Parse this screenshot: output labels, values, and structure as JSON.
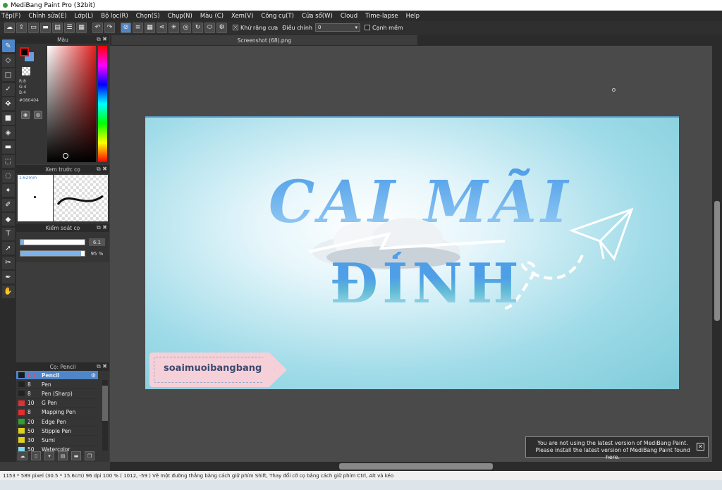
{
  "window": {
    "title": "MediBang Paint Pro (32bit)"
  },
  "menu": [
    "Tệp(F)",
    "Chỉnh sửa(E)",
    "Lớp(L)",
    "Bộ lọc(R)",
    "Chọn(S)",
    "Chụp(N)",
    "Màu (C)",
    "Xem(V)",
    "Công cụ(T)",
    "Cửa sổ(W)",
    "Cloud",
    "Time-lapse",
    "Help"
  ],
  "toolbar": {
    "antialias_label": "Khử răng cưa",
    "adjust_label": "Điều chỉnh",
    "adjust_value": "0",
    "soft_edge_label": "Cạnh mềm"
  },
  "color_panel": {
    "title": "Màu",
    "r": "R:8",
    "g": "G:4",
    "b": "B:4",
    "hex": "#080404",
    "fg_color": "#080404",
    "bg_color": "#6aa0e0"
  },
  "brush_preview": {
    "title": "Xem trước cọ",
    "size": "1.62mm"
  },
  "brush_control": {
    "title": "Kiểm soát cọ",
    "size_value": "6.1",
    "opacity_value": "95 %",
    "size_fraction": 0.06,
    "opacity_fraction": 0.95
  },
  "brush_list": {
    "title": "Cọ: Pencil",
    "items": [
      {
        "size": "6.1",
        "name": "Pencil",
        "color": "#4e86c9",
        "selected": true
      },
      {
        "size": "8",
        "name": "Pen",
        "color": "#222222",
        "selected": false
      },
      {
        "size": "8",
        "name": "Pen (Sharp)",
        "color": "#222222",
        "selected": false
      },
      {
        "size": "10",
        "name": "G Pen",
        "color": "#e03030",
        "selected": false
      },
      {
        "size": "8",
        "name": "Mapping Pen",
        "color": "#e03030",
        "selected": false
      },
      {
        "size": "20",
        "name": "Edge Pen",
        "color": "#30a030",
        "selected": false
      },
      {
        "size": "50",
        "name": "Stipple Pen",
        "color": "#e0d020",
        "selected": false
      },
      {
        "size": "30",
        "name": "Sumi",
        "color": "#e0d020",
        "selected": false
      },
      {
        "size": "50",
        "name": "Watercolor",
        "color": "#80d8f0",
        "selected": false
      }
    ]
  },
  "document": {
    "tab": "Screenshot (68).png"
  },
  "artwork": {
    "title_line1": "CAI MÃI",
    "title_line2": "ĐỈNH",
    "tag_text": "soaimuoibangbang"
  },
  "notice": {
    "line1": "You are not using the latest version of MediBang Paint.",
    "line2": "Please install the latest version of MediBang Paint found here."
  },
  "status": {
    "text": "1153 * 589 pixel   (30.5 * 15.6cm)   96 dpi   100 %   ( 1012, -59 )   Vẽ một đường thẳng bằng cách giữ phím Shift, Thay đổi cỡ cọ bằng cách giữ phím Ctrl, Alt và kéo"
  }
}
